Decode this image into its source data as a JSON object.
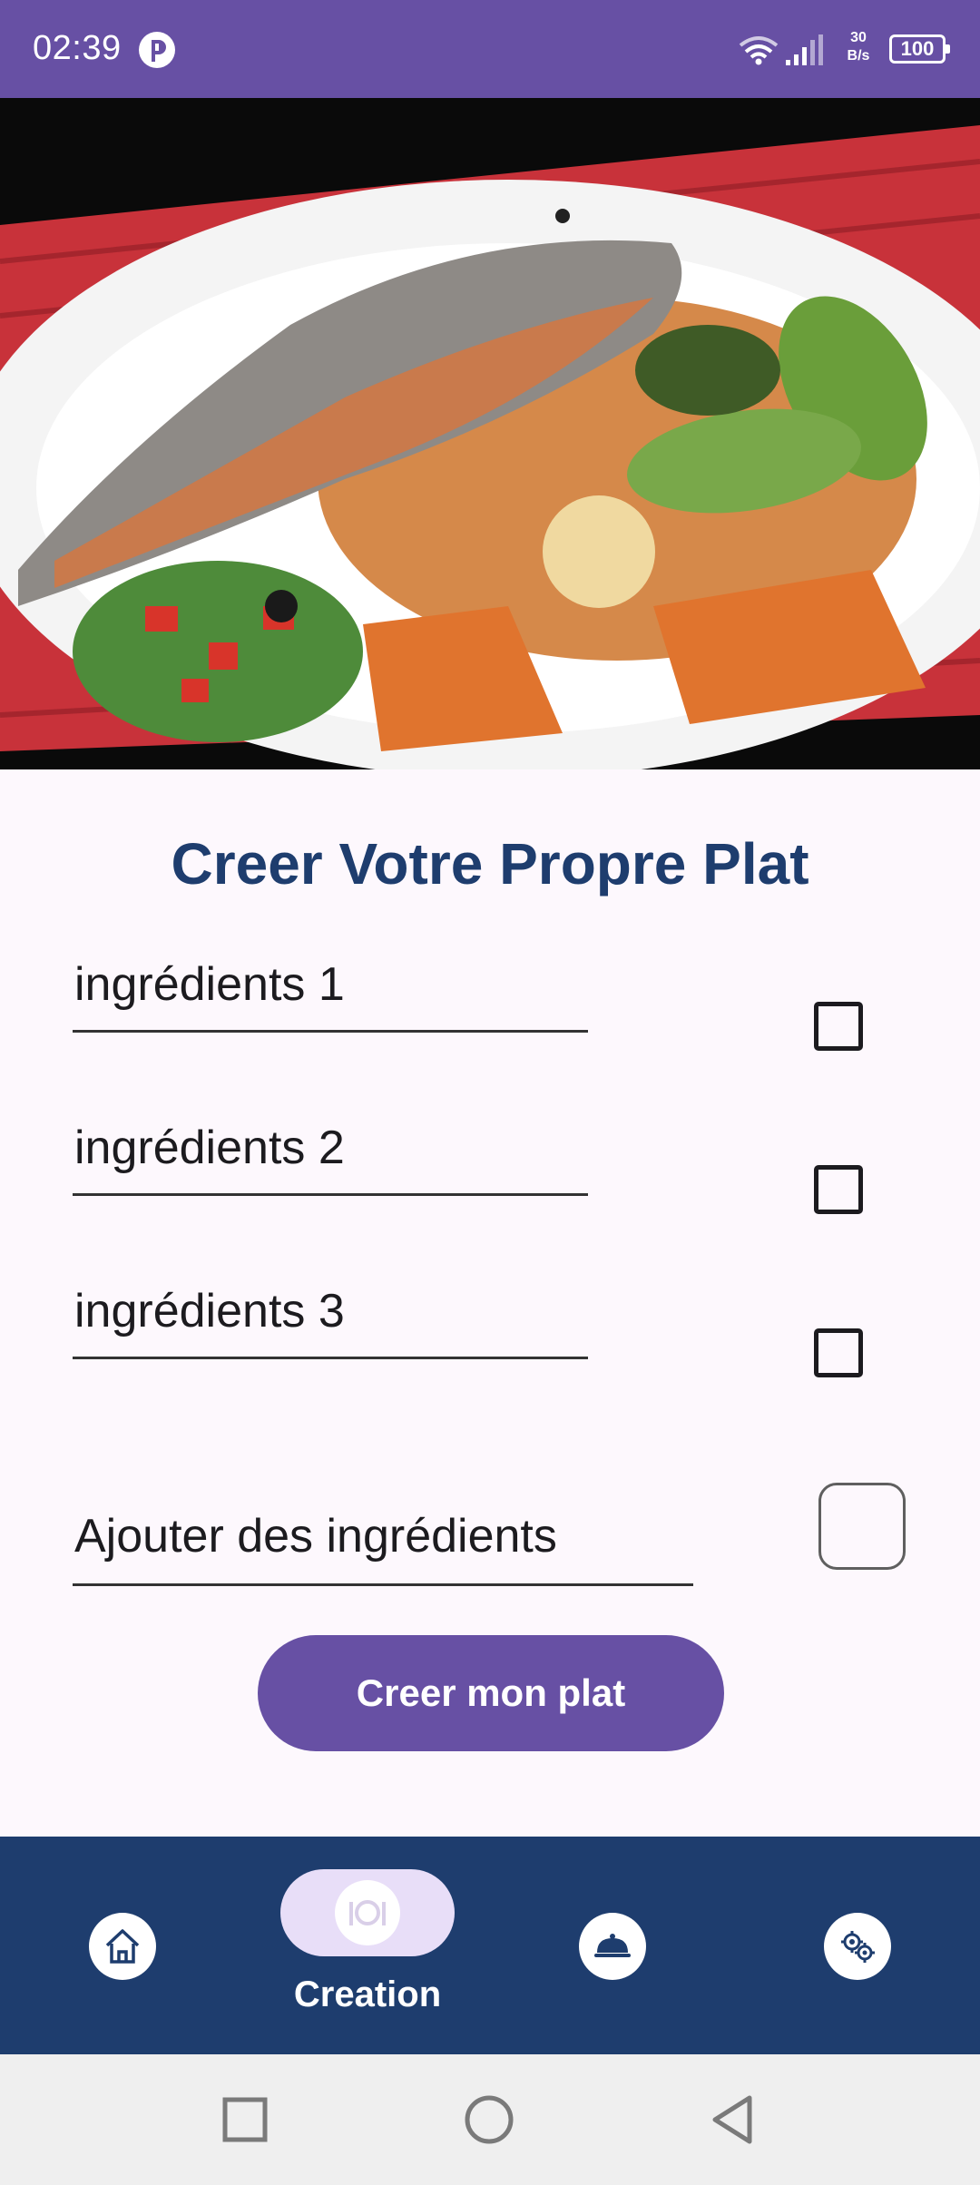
{
  "status_bar": {
    "time": "02:39",
    "speed_value": "30",
    "speed_unit": "B/s",
    "battery": "100"
  },
  "hero": {
    "image_description_icon": "fish-dish-photo"
  },
  "page_title": "Creer Votre Propre Plat",
  "ingredients": [
    {
      "label": "ingrédients 1",
      "checked": false
    },
    {
      "label": "ingrédients 2",
      "checked": false
    },
    {
      "label": "ingrédients 3",
      "checked": false
    }
  ],
  "add_ingredient": {
    "label": "Ajouter des ingrédients"
  },
  "create_button_label": "Creer mon plat",
  "bottom_nav": {
    "items": [
      {
        "icon": "home-icon"
      },
      {
        "icon": "dish-icon",
        "label": "Creation",
        "active": true
      },
      {
        "icon": "cloche-icon"
      },
      {
        "icon": "settings-gears-icon"
      }
    ]
  },
  "colors": {
    "primary": "#6750a4",
    "nav_background": "#1e3d6e",
    "title": "#1e3d6e",
    "active_pill": "#e8def8"
  }
}
